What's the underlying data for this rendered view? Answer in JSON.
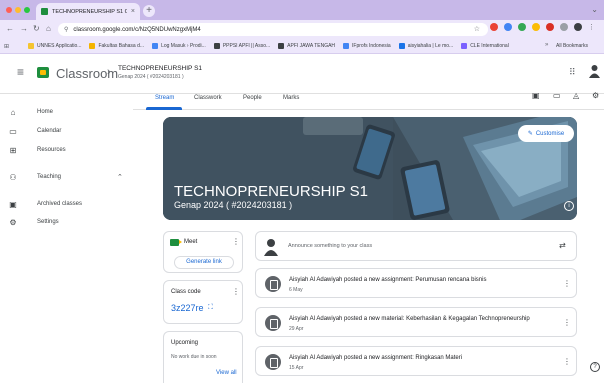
{
  "browser": {
    "tab_title": "TECHNOPRENEURSHIP S1 C",
    "tab_close": "×",
    "new_tab": "+",
    "tab_menu": "⌄",
    "url": "classroom.google.com/c/NzQ5NDUwNzgxMjM4",
    "bookmarks": [
      {
        "label": "UNNES Applicatio...",
        "color": "#f4c430"
      },
      {
        "label": "Fakultas Bahasa d...",
        "color": "#f4b400"
      },
      {
        "label": "Log Masuk › Prodi...",
        "color": "#4285f4"
      },
      {
        "label": "PPPSI APFI || Asso...",
        "color": "#3c4043"
      },
      {
        "label": "APFI JAWA TENGAH",
        "color": "#3c4043"
      },
      {
        "label": "IFprofs Indonesia",
        "color": "#4285f4"
      },
      {
        "label": "aisyiahalia | Le mo...",
        "color": "#1a73e8"
      },
      {
        "label": "CLE International",
        "color": "#7b61ff"
      }
    ],
    "bookmarks_more": "»",
    "all_bookmarks": "All Bookmarks"
  },
  "header": {
    "app_name": "Classroom",
    "crumb_sep": "›",
    "course_name": "TECHNOPRENEURSHIP S1",
    "course_sub": "Genap 2024 ( #2024203181 )"
  },
  "sidebar": {
    "items": [
      {
        "label": "Home",
        "icon": "⌂"
      },
      {
        "label": "Calendar",
        "icon": "▭"
      },
      {
        "label": "Resources",
        "icon": "⊞"
      },
      {
        "label": "Teaching",
        "icon": "⚇",
        "chevron": "⌃"
      },
      {
        "label": "Archived classes",
        "icon": "▣"
      },
      {
        "label": "Settings",
        "icon": "⚙"
      }
    ]
  },
  "tabs": [
    "Stream",
    "Classwork",
    "People",
    "Marks"
  ],
  "banner": {
    "title": "TECHNOPRENEURSHIP S1",
    "subtitle": "Genap 2024 ( #2024203181 )",
    "customise_label": "Customise"
  },
  "meet": {
    "label": "Meet",
    "button": "Generate link"
  },
  "class_code": {
    "label": "Class code",
    "value": "3z227re"
  },
  "upcoming": {
    "label": "Upcoming",
    "empty": "No work due in soon",
    "view_all": "View all"
  },
  "announce": {
    "placeholder": "Announce something to your class"
  },
  "posts": [
    {
      "title": "Aisyiah Al Adawiyah posted a new assignment: Perumusan rencana bisnis",
      "date": "6 May"
    },
    {
      "title": "Aisyiah Al Adawiyah posted a new material: Keberhasilan & Kegagalan Technopreneurship",
      "date": "29 Apr"
    },
    {
      "title": "Aisyiah Al Adawiyah posted a new assignment: Ringkasan Materi",
      "date": "15 Apr"
    }
  ],
  "colors": {
    "accent": "#1967d2",
    "brand": "#1e8e3e",
    "chrome": "#ede7fb"
  }
}
